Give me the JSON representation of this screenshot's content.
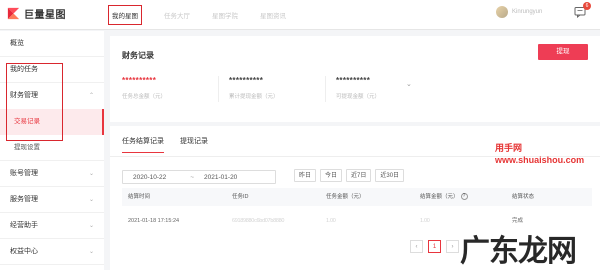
{
  "brand": {
    "name": "巨量星图"
  },
  "top_nav": [
    {
      "label": "我的星图",
      "active": true
    },
    {
      "label": "任务大厅",
      "active": false
    },
    {
      "label": "星图学院",
      "active": false
    },
    {
      "label": "星图资讯",
      "active": false
    }
  ],
  "user": {
    "name": "Kinrungyun",
    "message_count": "6"
  },
  "sidebar": {
    "items": [
      {
        "label": "概览"
      },
      {
        "label": "我的任务"
      },
      {
        "label": "财务管理",
        "chevron": "⌃"
      },
      {
        "label": "交易记录",
        "sub": true,
        "active": true
      },
      {
        "label": "提现设置",
        "sub": true
      },
      {
        "label": "账号管理",
        "chevron": "⌄"
      },
      {
        "label": "服务管理",
        "chevron": "⌄"
      },
      {
        "label": "经营助手",
        "chevron": "⌄"
      },
      {
        "label": "权益中心",
        "chevron": "⌄"
      }
    ]
  },
  "finance": {
    "title": "财务记录",
    "withdraw_label": "提现",
    "stats": [
      {
        "value": "**********",
        "label": "任务总金额（元）",
        "red": true
      },
      {
        "value": "**********",
        "label": "累计提现金额（元）"
      },
      {
        "value": "**********",
        "label": "可提现金额（元）"
      }
    ],
    "expand_icon": "⌄"
  },
  "records": {
    "tabs": [
      {
        "label": "任务结算记录",
        "active": true
      },
      {
        "label": "提现记录",
        "active": false
      }
    ],
    "date_start": "2020-10-22",
    "date_sep": "~",
    "date_end": "2021-01-20",
    "quick_ranges": [
      "昨日",
      "今日",
      "近7日",
      "近30日"
    ],
    "columns": [
      "结算时间",
      "任务ID",
      "任务金额（元）",
      "结算金额（元）",
      "结算状态"
    ],
    "rows": [
      {
        "time": "2021-01-18 17:15:24",
        "task_id": "69189880c6bd07b8880",
        "amount": "1.00",
        "settle": "1.00",
        "status": "完成"
      }
    ],
    "pager": {
      "prev": "‹",
      "page": "1",
      "next": "›"
    }
  },
  "watermark": {
    "line1": "用手网",
    "line2": "www.shuaishou.com",
    "big": "广东龙网"
  },
  "colors": {
    "accent": "#e8353e",
    "highlight_box": "#d9272e",
    "button": "#ee3d55"
  }
}
